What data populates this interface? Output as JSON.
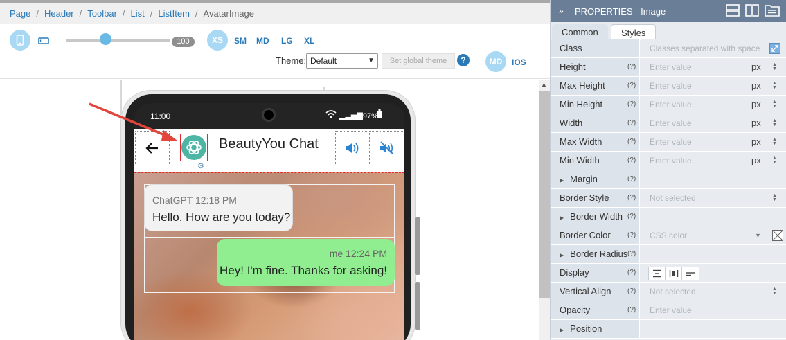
{
  "breadcrumb": [
    "Page",
    "Header",
    "Toolbar",
    "List",
    "ListItem",
    "AvatarImage"
  ],
  "toolbar": {
    "zoom_value": "100",
    "zoom_fraction": 0.38,
    "breakpoints": [
      "XS",
      "SM",
      "MD",
      "LG",
      "XL"
    ],
    "theme_label": "Theme:",
    "theme_selected": "Default",
    "set_theme_button": "Set global theme",
    "help_glyph": "?",
    "platform_badge": "MD",
    "platform_ios": "IOS"
  },
  "phone": {
    "status_time": "11:00",
    "status_battery": "97%",
    "chat_title": "BeautyYou Chat",
    "messages": [
      {
        "direction": "in",
        "meta": "ChatGPT 12:18 PM",
        "text": "Hello. How are you today?"
      },
      {
        "direction": "out",
        "meta": "me 12:24 PM",
        "text": "Hey! I'm fine. Thanks for asking!"
      }
    ]
  },
  "props": {
    "title": "PROPERTIES - Image",
    "collapse_glyph": "»",
    "tabs": [
      "Common",
      "Styles"
    ],
    "active_tab": "Styles",
    "help": "(?)",
    "rows": [
      {
        "label": "Class",
        "placeholder": "Classes separated with space"
      },
      {
        "label": "Height",
        "placeholder": "Enter value",
        "unit": "px"
      },
      {
        "label": "Max Height",
        "placeholder": "Enter value",
        "unit": "px"
      },
      {
        "label": "Min Height",
        "placeholder": "Enter value",
        "unit": "px"
      },
      {
        "label": "Width",
        "placeholder": "Enter value",
        "unit": "px"
      },
      {
        "label": "Max Width",
        "placeholder": "Enter value",
        "unit": "px"
      },
      {
        "label": "Min Width",
        "placeholder": "Enter value",
        "unit": "px"
      },
      {
        "label": "Margin"
      },
      {
        "label": "Border Style",
        "placeholder": "Not selected"
      },
      {
        "label": "Border Width"
      },
      {
        "label": "Border Color",
        "placeholder": "CSS color"
      },
      {
        "label": "Border Radius"
      },
      {
        "label": "Display"
      },
      {
        "label": "Vertical Align",
        "placeholder": "Not selected"
      },
      {
        "label": "Opacity",
        "placeholder": "Enter value"
      },
      {
        "label": "Position"
      }
    ]
  },
  "colors": {
    "accent": "#2a7ab8",
    "panel_header": "#6a7f97",
    "incoming_bubble": "#f2f2f2",
    "outgoing_bubble": "#90ee90",
    "avatar": "#4cb5a4",
    "selection_outline": "#e0282f",
    "pointer_arrow": "#e2453c"
  }
}
